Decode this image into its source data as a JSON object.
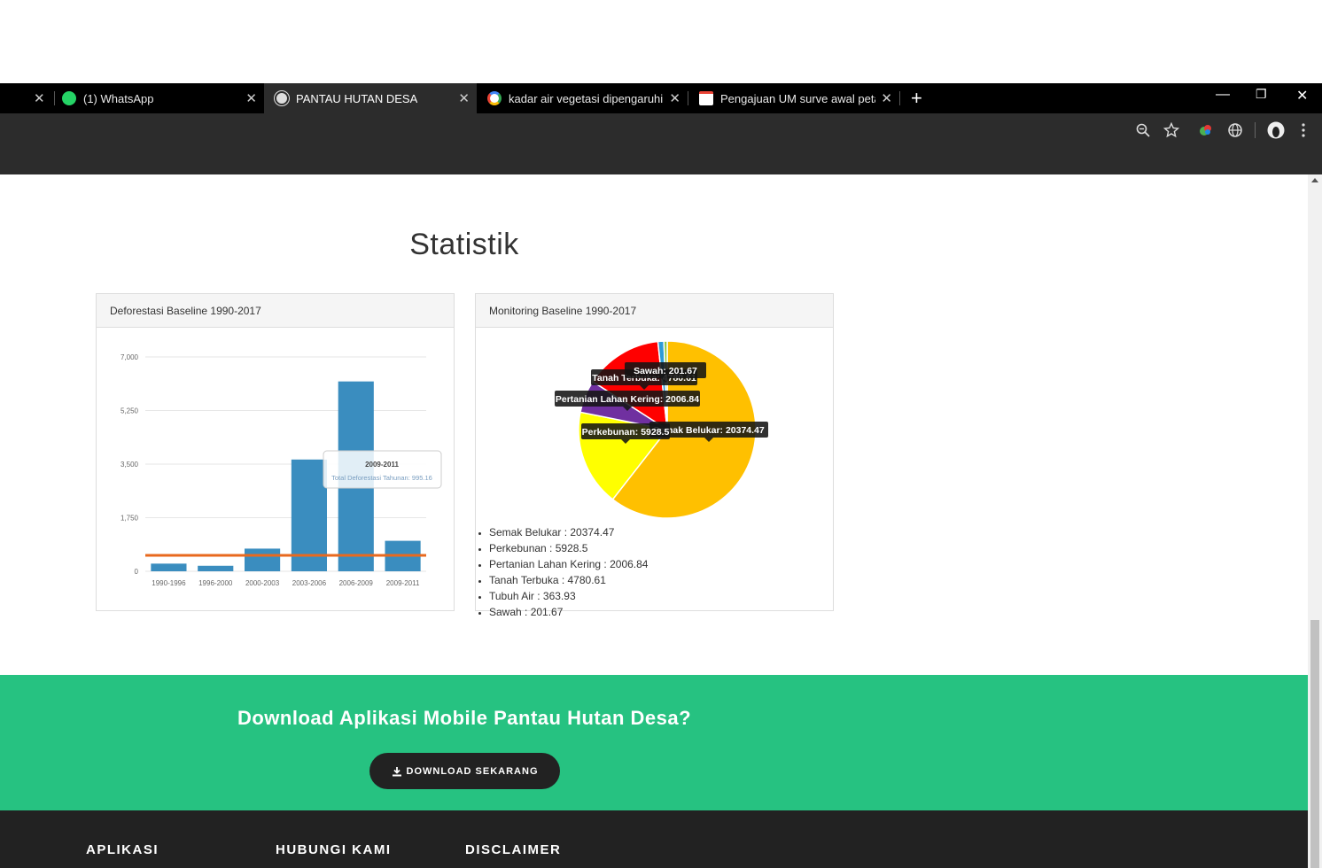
{
  "browser": {
    "tabs": [
      {
        "label": "(1) WhatsApp",
        "icon": "whatsapp-icon"
      },
      {
        "label": "PANTAU HUTAN DESA",
        "icon": "globe-icon",
        "active": true
      },
      {
        "label": "kadar air vegetasi dipengaruhi ol",
        "icon": "google-icon"
      },
      {
        "label": "Pengajuan UM surve awal petani",
        "icon": "gmail-icon"
      }
    ],
    "new_tab": "+",
    "win_min": "—",
    "win_restore": "❐",
    "win_close": "✕"
  },
  "page": {
    "section_title": "Statistik",
    "card1_title": "Deforestasi Baseline 1990-2017",
    "card2_title": "Monitoring Baseline 1990-2017",
    "download_title": "Download Aplikasi Mobile Pantau Hutan Desa?",
    "download_button": "DOWNLOAD SEKARANG",
    "footer_headings": [
      "APLIKASI",
      "HUBUNGI KAMI",
      "DISCLAIMER"
    ]
  },
  "colors": {
    "bar": "#3a8dbf",
    "avg_line": "#e8691e",
    "green_band": "#26c281"
  },
  "chart_data": [
    {
      "type": "bar",
      "categories": [
        "1990-1996",
        "1996-2000",
        "2000-2003",
        "2003-2006",
        "2006-2009",
        "2009-2011"
      ],
      "values": [
        250,
        180,
        740,
        3650,
        6200,
        995.16
      ],
      "ylim": [
        0,
        7000
      ],
      "yticks": [
        "0",
        "1,750",
        "3,500",
        "5,250",
        "7,000"
      ],
      "ytick_values": [
        0,
        1750,
        3500,
        5250,
        7000
      ],
      "average_line": 520,
      "tooltip": {
        "title": "2009-2011",
        "text": "Total Deforestasi Tahunan: 995.16"
      },
      "grid": true
    },
    {
      "type": "pie",
      "slices": [
        {
          "label": "Semak Belukar",
          "value": 20374.47,
          "color": "#ffc000"
        },
        {
          "label": "Perkebunan",
          "value": 5928.5,
          "color": "#ffff00"
        },
        {
          "label": "Pertanian Lahan Kering",
          "value": 2006.84,
          "color": "#7030a0"
        },
        {
          "label": "Tanah Terbuka",
          "value": 4780.61,
          "color": "#ff0000"
        },
        {
          "label": "Tubuh Air",
          "value": 363.93,
          "color": "#2e9bd6"
        },
        {
          "label": "Sawah",
          "value": 201.67,
          "color": "#8fc73e"
        }
      ],
      "tooltips": [
        "Sawah: 201.67",
        "Tanah Terbuka: 4780.61",
        "Pertanian Lahan Kering: 2006.84",
        "Semak Belukar: 20374.47",
        "Perkebunan: 5928.5"
      ],
      "legend_items": [
        "Semak Belukar : 20374.47",
        "Perkebunan : 5928.5",
        "Pertanian Lahan Kering : 2006.84",
        "Tanah Terbuka : 4780.61",
        "Tubuh Air : 363.93",
        "Sawah : 201.67"
      ]
    }
  ]
}
